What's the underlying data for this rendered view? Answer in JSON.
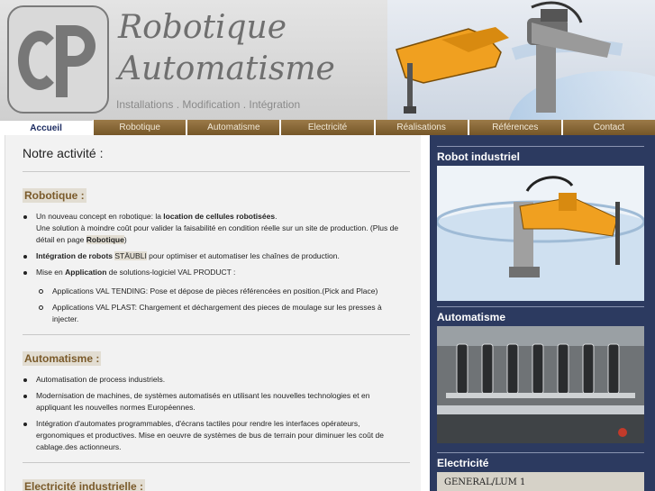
{
  "header": {
    "title_line1": "Robotique",
    "title_line2": "Automatisme",
    "tagline": "Installations . Modification . Intégration"
  },
  "nav": [
    {
      "label": "Accueil",
      "active": true
    },
    {
      "label": "Robotique"
    },
    {
      "label": "Automatisme"
    },
    {
      "label": "Electricité"
    },
    {
      "label": "Réalisations"
    },
    {
      "label": "Références"
    },
    {
      "label": "Contact"
    }
  ],
  "main": {
    "title": "Notre activité :",
    "robotique": {
      "heading": "Robotique :",
      "item1_a": "Un nouveau concept en robotique: la ",
      "item1_b": "location de cellules robotisées",
      "item1_c": ".",
      "item1_d": "Une solution à moindre coût pour valider la faisabilité en condition réelle sur un site de production. (Plus de détail en page ",
      "item1_link": "Robotique",
      "item1_e": ")",
      "item2_a": "Intégration de robots ",
      "item2_brand": "STÄUBLI",
      "item2_b": " pour optimiser et automatiser les chaînes de production.",
      "item3_a": "Mise en ",
      "item3_b": "Application",
      "item3_c": " de solutions-logiciel VAL PRODUCT :",
      "sub1": "Applications VAL TENDING: Pose et dépose de pièces référencées en position.(Pick and Place)",
      "sub2": "Applications VAL PLAST: Chargement et déchargement des pieces de moulage sur les presses à injecter."
    },
    "automatisme": {
      "heading": "Automatisme :",
      "item1": "Automatisation de process industriels.",
      "item2": "Modernisation de machines, de systèmes automatisés en utilisant les nouvelles technologies et en appliquant les nouvelles normes Européennes.",
      "item3": "Intégration d'automates programmables, d'écrans tactiles pour rendre les interfaces opérateurs, ergonomiques et productives. Mise en oeuvre de systèmes de bus de terrain pour diminuer les coût de cablage.des actionneurs."
    },
    "electricite": {
      "heading": "Electricité industrielle :"
    }
  },
  "sidebar": {
    "robot_title": "Robot industriel",
    "automatisme_title": "Automatisme",
    "electricite_title": "Electricité",
    "panel_label": "GENERAL/LUM 1"
  },
  "colors": {
    "nav_bg": "#8b6a3c",
    "sidebar_bg": "#2c3a60",
    "heading_brown": "#7a5a2a",
    "robot_orange": "#f0a020"
  }
}
